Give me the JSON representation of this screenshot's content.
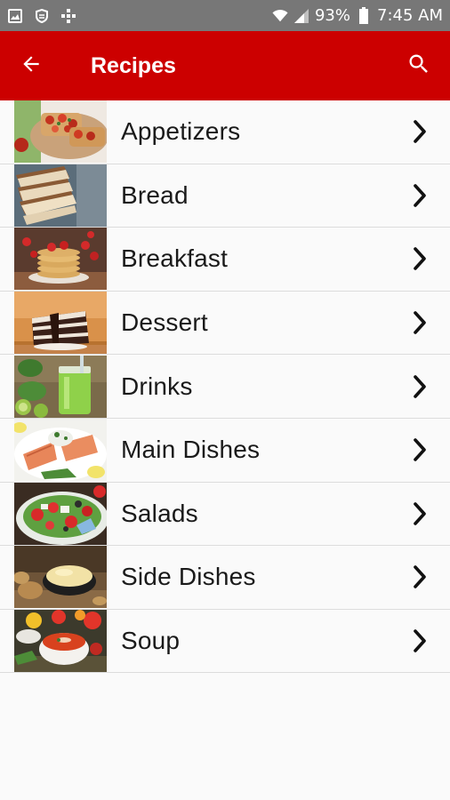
{
  "status_bar": {
    "battery": "93%",
    "time": "7:45 AM",
    "icons": [
      "image-icon",
      "shield-icon",
      "grid-icon",
      "wifi-icon",
      "signal-icon",
      "battery-icon"
    ]
  },
  "app_bar": {
    "title": "Recipes",
    "background": "#cc0000",
    "back_icon": "arrow-left-icon",
    "search_icon": "search-icon"
  },
  "categories": [
    {
      "label": "Appetizers",
      "thumbnail": "bruschetta"
    },
    {
      "label": "Bread",
      "thumbnail": "sliced-bread"
    },
    {
      "label": "Breakfast",
      "thumbnail": "pancakes-with-strawberries"
    },
    {
      "label": "Dessert",
      "thumbnail": "chocolate-cake-slice"
    },
    {
      "label": "Drinks",
      "thumbnail": "green-smoothie"
    },
    {
      "label": "Main Dishes",
      "thumbnail": "grilled-salmon"
    },
    {
      "label": "Salads",
      "thumbnail": "fresh-salad"
    },
    {
      "label": "Side Dishes",
      "thumbnail": "mashed-potatoes"
    },
    {
      "label": "Soup",
      "thumbnail": "tomato-soup"
    }
  ]
}
